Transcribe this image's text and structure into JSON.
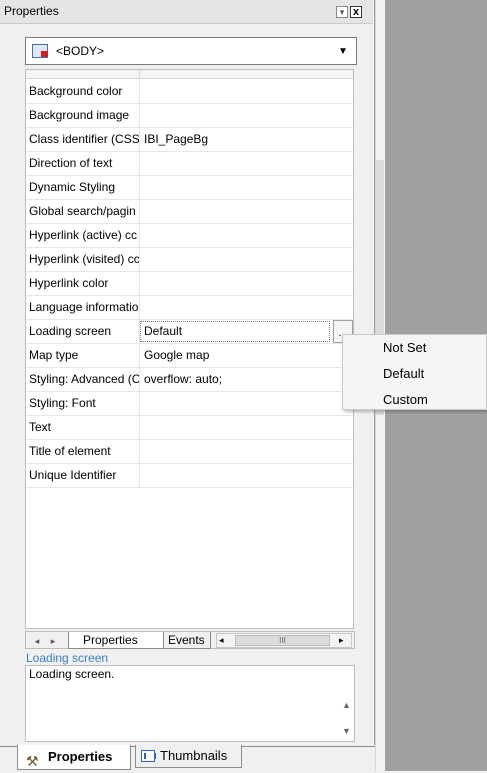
{
  "panel": {
    "title": "Properties",
    "pin_glyph": "▾",
    "close_glyph": "x",
    "object_selector": {
      "value": "<BODY>",
      "arrow": "▼",
      "icon": "element-icon"
    }
  },
  "grid": {
    "rows": [
      {
        "name": "Background color",
        "value": ""
      },
      {
        "name": "Background image",
        "value": ""
      },
      {
        "name": "Class identifier (CSS)",
        "value": "IBI_PageBg"
      },
      {
        "name": "Direction of text",
        "value": ""
      },
      {
        "name": "Dynamic Styling",
        "value": ""
      },
      {
        "name": "Global search/pagin",
        "value": ""
      },
      {
        "name": "Hyperlink (active) cc",
        "value": ""
      },
      {
        "name": "Hyperlink (visited) cc",
        "value": ""
      },
      {
        "name": "Hyperlink color",
        "value": ""
      },
      {
        "name": "Language informatio",
        "value": ""
      },
      {
        "name": "Loading screen",
        "value": "Default",
        "selected": true,
        "button": "..."
      },
      {
        "name": "Map type",
        "value": "Google map"
      },
      {
        "name": "Styling: Advanced (C",
        "value": "overflow: auto;"
      },
      {
        "name": "Styling: Font",
        "value": ""
      },
      {
        "name": "Text",
        "value": ""
      },
      {
        "name": "Title of element",
        "value": ""
      },
      {
        "name": "Unique Identifier",
        "value": ""
      }
    ]
  },
  "dropdown": {
    "options": [
      "Not Set",
      "Default",
      "Custom"
    ]
  },
  "tabs": {
    "nav_left": "◂",
    "nav_right": "▸",
    "properties": "Properties",
    "events": "Events",
    "scroll_left": "◂",
    "scroll_thumb": "III",
    "scroll_right": "▸"
  },
  "description": {
    "title": "Loading screen",
    "text": "Loading screen.",
    "up": "▲",
    "down": "▼"
  },
  "bottom_tabs": {
    "properties": "Properties",
    "properties_icon": "properties-icon",
    "thumbnails": "Thumbnails",
    "thumbnails_icon": "thumbnails-icon"
  }
}
